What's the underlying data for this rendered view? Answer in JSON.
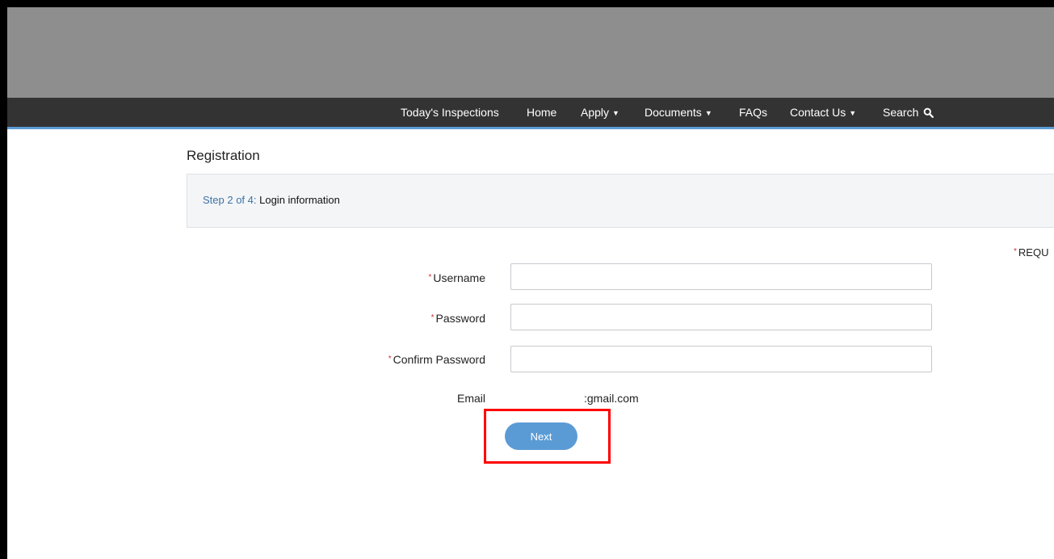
{
  "nav": {
    "items": [
      {
        "label": "Today's Inspections",
        "dropdown": false
      },
      {
        "label": "Home",
        "dropdown": false
      },
      {
        "label": "Apply",
        "dropdown": true
      },
      {
        "label": "Documents",
        "dropdown": true
      },
      {
        "label": "FAQs",
        "dropdown": false
      },
      {
        "label": "Contact Us",
        "dropdown": true
      },
      {
        "label": "Search",
        "dropdown": false,
        "icon": "search-icon"
      }
    ],
    "caret_icon": "caret-down-icon"
  },
  "page": {
    "title": "Registration",
    "step_number": "Step 2 of 4:",
    "step_label": " Login information",
    "required_note": "REQU"
  },
  "form": {
    "required_marker": "*",
    "username_label": "Username",
    "username_value": "",
    "password_label": "Password",
    "password_value": "",
    "confirm_password_label": "Confirm Password",
    "confirm_password_value": "",
    "email_label": "Email",
    "email_value": ":gmail.com",
    "next_label": "Next"
  },
  "colors": {
    "banner": "#8e8e8e",
    "navbar": "#333333",
    "accent": "#5b9bd5",
    "step_number": "#3b73a7",
    "required_star": "#d32f2f",
    "highlight": "#ff0000"
  }
}
